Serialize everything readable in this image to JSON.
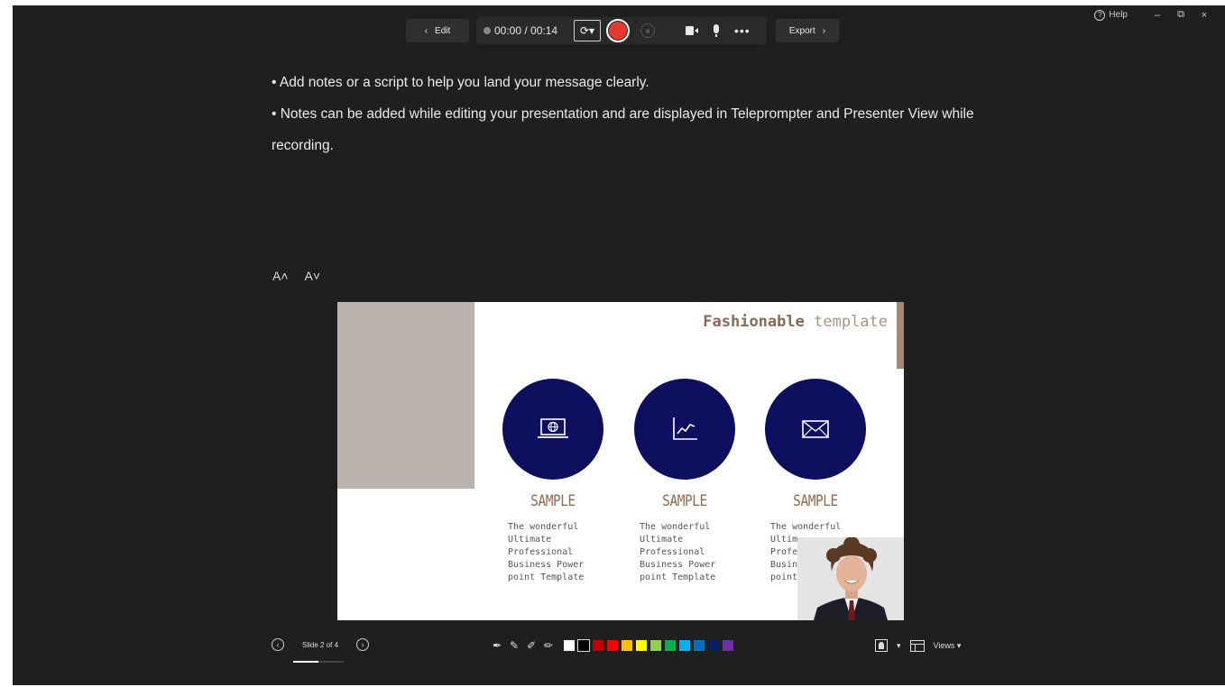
{
  "window": {
    "help_label": "Help",
    "minimize_glyph": "–",
    "restore_glyph": "⧉",
    "close_glyph": "×"
  },
  "toolbar": {
    "edit_label": "Edit",
    "export_label": "Export",
    "time_display": "00:00 / 00:14",
    "mode_glyph": "⟳▾",
    "more_glyph": "•••"
  },
  "notes": {
    "line1": "• Add notes or a script to help you land your message clearly.",
    "line2": "• Notes can be added while editing your presentation and are displayed in Teleprompter and Presenter View while recording."
  },
  "font_controls": {
    "increase": "A˄",
    "decrease": "A˅"
  },
  "slide": {
    "title_bold": "Fashionable",
    "title_light": "template",
    "columns": [
      {
        "icon": "laptop-globe-icon",
        "heading": "SAMPLE",
        "text": "The wonderful\nUltimate\nProfessional\nBusiness Power\npoint Template"
      },
      {
        "icon": "line-chart-icon",
        "heading": "SAMPLE",
        "text": "The wonderful\nUltimate\nProfessional\nBusiness Power\npoint Template"
      },
      {
        "icon": "envelope-icon",
        "heading": "SAMPLE",
        "text": "The wonderful\nUltim\nProfe\nBusin\npoint"
      }
    ],
    "colors": {
      "circle": "#0e0f5e",
      "accent": "#a58a78",
      "heading": "#8f6a52",
      "graybox": "#bcb3ae"
    }
  },
  "bottom": {
    "slide_indicator": "Slide 2 of 4",
    "progress": 0.5,
    "views_label": "Views ▾",
    "person_dropdown": "▾",
    "prev_glyph": "‹",
    "next_glyph": "›"
  },
  "pen_tools": [
    "pen-icon",
    "highlighter-icon",
    "laser-pointer-icon",
    "eraser-icon"
  ],
  "swatches": [
    "#ffffff",
    "#000000",
    "#c00000",
    "#ff0000",
    "#ffc000",
    "#ffff00",
    "#92d050",
    "#00b050",
    "#00b0f0",
    "#0070c0",
    "#002060",
    "#7030a0"
  ]
}
